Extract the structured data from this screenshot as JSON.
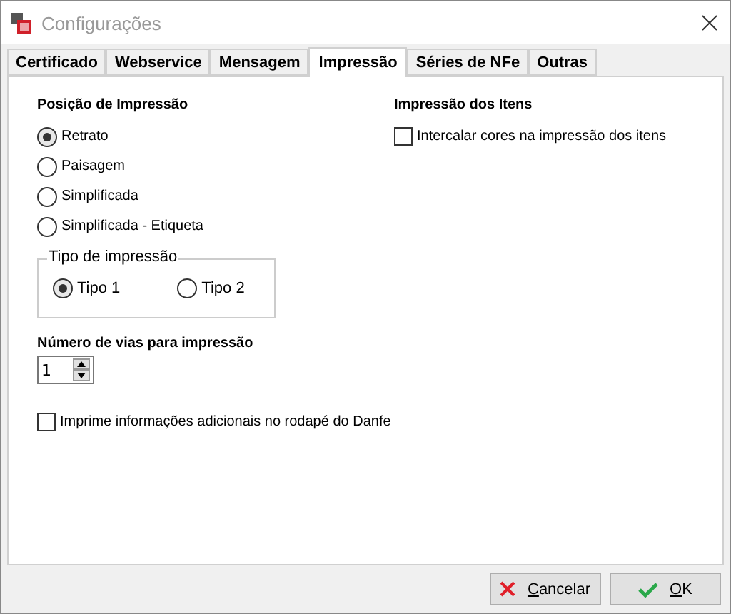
{
  "window": {
    "title": "Configurações"
  },
  "tabs": [
    {
      "label": "Certificado",
      "selected": false
    },
    {
      "label": "Webservice",
      "selected": false
    },
    {
      "label": "Mensagem",
      "selected": false
    },
    {
      "label": "Impressão",
      "selected": true
    },
    {
      "label": "Séries de NFe",
      "selected": false
    },
    {
      "label": "Outras",
      "selected": false
    }
  ],
  "print_position": {
    "title": "Posição de Impressão",
    "options": [
      {
        "label": "Retrato",
        "selected": true
      },
      {
        "label": "Paisagem",
        "selected": false
      },
      {
        "label": "Simplificada",
        "selected": false
      },
      {
        "label": "Simplificada - Etiqueta",
        "selected": false
      }
    ]
  },
  "print_type": {
    "title": "Tipo de impressão",
    "options": [
      {
        "label": "Tipo 1",
        "selected": true
      },
      {
        "label": "Tipo 2",
        "selected": false
      }
    ]
  },
  "copies": {
    "label": "Número de vias para impressão",
    "value": "1"
  },
  "footer_info": {
    "label": "Imprime informações adicionais no rodapé do Danfe",
    "checked": false
  },
  "items_printing": {
    "title": "Impressão dos Itens",
    "option": {
      "label": "Intercalar cores na impressão dos itens",
      "checked": false
    }
  },
  "buttons": [
    {
      "label": "Cancelar",
      "kind": "cancel"
    },
    {
      "label": "OK",
      "kind": "ok"
    }
  ]
}
